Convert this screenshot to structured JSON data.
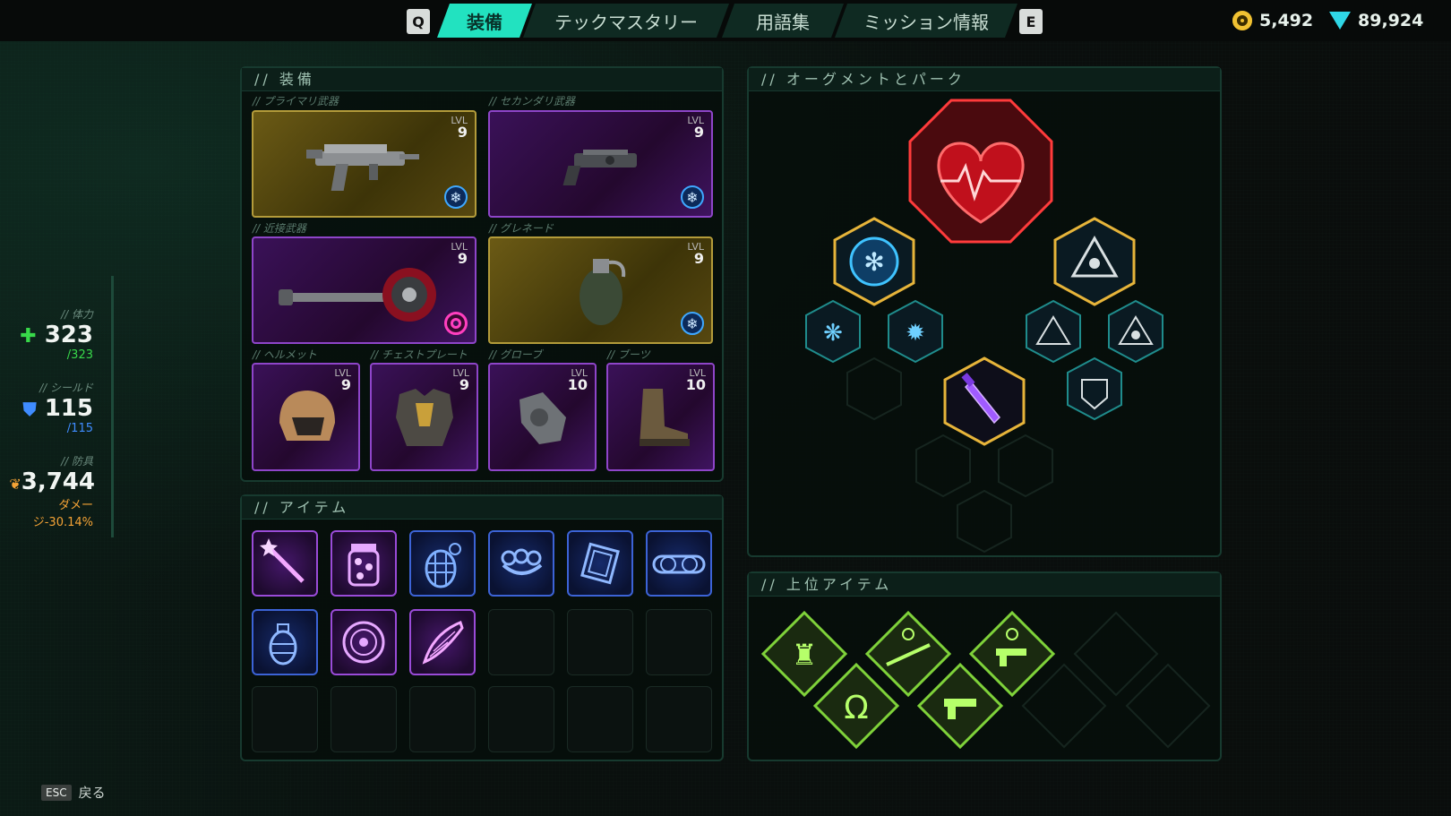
{
  "topbar": {
    "left_key": "Q",
    "right_key": "E",
    "tabs": [
      {
        "label": "装備"
      },
      {
        "label": "テックマスタリー"
      },
      {
        "label": "用語集"
      },
      {
        "label": "ミッション情報"
      }
    ],
    "active_tab": "装備",
    "currency_gold": "5,492",
    "currency_gems": "89,924"
  },
  "stats": {
    "health_label": "// 体力",
    "health": "323",
    "health_max": "/323",
    "shield_label": "// シールド",
    "shield": "115",
    "shield_max": "/115",
    "armor_label": "// 防具",
    "armor": "3,744",
    "armor_note_1": "ダメー",
    "armor_note_2": "ジ-30.14%"
  },
  "equipment": {
    "title": "//  装備",
    "primary_label": "// プライマリ武器",
    "primary_lvl": "9",
    "primary_icon": "smg-icon",
    "primary_element": "frost-icon",
    "secondary_label": "// セカンダリ武器",
    "secondary_lvl": "9",
    "secondary_icon": "pistol-icon",
    "secondary_element": "frost-icon",
    "melee_label": "// 近接武器",
    "melee_lvl": "9",
    "melee_icon": "chainsaw-axe-icon",
    "melee_element": "spiral-icon",
    "grenade_label": "// グレネード",
    "grenade_lvl": "9",
    "grenade_icon": "grenade-icon",
    "grenade_element": "frost-icon",
    "helmet_label": "// ヘルメット",
    "helmet_lvl": "9",
    "chest_label": "// チェストプレート",
    "chest_lvl": "9",
    "glove_label": "// グローブ",
    "glove_lvl": "10",
    "boots_label": "// ブーツ",
    "boots_lvl": "10",
    "lvl_text": "LVL"
  },
  "items": {
    "title": "//  アイテム",
    "list": [
      {
        "icon": "magic-wand-icon",
        "rarity": "purple"
      },
      {
        "icon": "candy-jar-icon",
        "rarity": "purple"
      },
      {
        "icon": "net-grenade-icon",
        "rarity": "blue"
      },
      {
        "icon": "brass-knuckles-icon",
        "rarity": "blue"
      },
      {
        "icon": "armor-plate-icon",
        "rarity": "blue"
      },
      {
        "icon": "goggles-icon",
        "rarity": "blue"
      },
      {
        "icon": "grenade-icon",
        "rarity": "blue"
      },
      {
        "icon": "disc-icon",
        "rarity": "purple"
      },
      {
        "icon": "catch-net-icon",
        "rarity": "purple"
      }
    ]
  },
  "augments": {
    "title": "//  オーグメントとパーク",
    "core": "heart-icon",
    "nodes": [
      "frost-burst-icon",
      "tri-blade-icon",
      "frost-bug-icon",
      "frost-shard-icon",
      "shield-tank-icon",
      "skull-tri-icon",
      "dagger-icon",
      "castle-shield-icon"
    ]
  },
  "top_items": {
    "title": "//  上位アイテム",
    "list": [
      "robot-icon",
      "rifle-keychain-icon",
      "pistol-keychain-icon",
      "omega-icon",
      "pistol-icon"
    ]
  },
  "colors": {
    "accent": "#22e2c0",
    "gold": "#b39b3a",
    "purple": "#8e45c9",
    "health": "#38d94a",
    "shield": "#3f8cff",
    "armor": "#f4a336",
    "top_item": "#7fd23a"
  },
  "footer": {
    "key": "ESC",
    "label": "戻る"
  }
}
